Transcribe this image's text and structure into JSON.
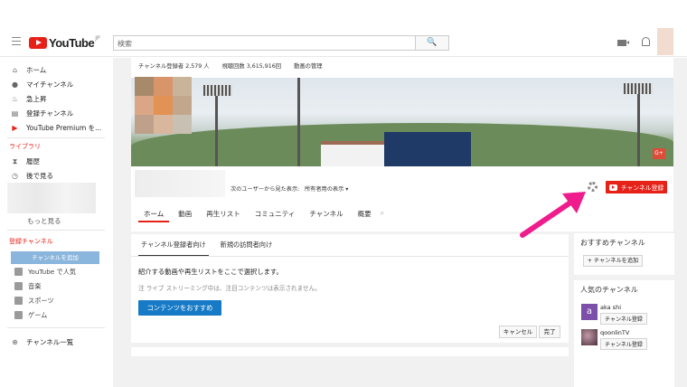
{
  "header": {
    "logo_text": "YouTube",
    "logo_region": "JP",
    "search_placeholder": "検索",
    "search_button": "🔍"
  },
  "sidebar": {
    "items": [
      {
        "label": "ホーム",
        "icon": "home-icon",
        "glyph": "⌂"
      },
      {
        "label": "マイチャンネル",
        "icon": "user-icon",
        "glyph": "●"
      },
      {
        "label": "急上昇",
        "icon": "fire-icon",
        "glyph": "♨"
      },
      {
        "label": "登録チャンネル",
        "icon": "subscriptions-icon",
        "glyph": "▤"
      },
      {
        "label": "YouTube Premium を...",
        "icon": "premium-icon",
        "glyph": "▶"
      }
    ],
    "library_heading": "ライブラリ",
    "library_items": [
      {
        "label": "履歴",
        "icon": "history-icon",
        "glyph": "⧗"
      },
      {
        "label": "後で見る",
        "icon": "clock-icon",
        "glyph": "◷"
      }
    ],
    "more_label": "もっと見る",
    "subscriptions_heading": "登録チャンネル",
    "add_channel_button": "チャンネルを追加",
    "sub_items": [
      {
        "label": "YouTube で人気"
      },
      {
        "label": "音楽"
      },
      {
        "label": "スポーツ"
      },
      {
        "label": "ゲーム"
      }
    ],
    "channel_list_label": "チャンネル一覧"
  },
  "channel": {
    "subscribers": "チャンネル登録者 2,579 人",
    "views": "視聴回数 3,615,916回",
    "manage_videos": "動画の管理",
    "viewer_label": "次のユーザーから見た表示:",
    "viewer_value": "所有者用の表示 ▾",
    "subscribe_button": "チャンネル登録",
    "gplus": "G+",
    "tabs": [
      "ホーム",
      "動画",
      "再生リスト",
      "コミュニティ",
      "チャンネル",
      "概要"
    ]
  },
  "panel": {
    "tabs": [
      "チャンネル登録者向け",
      "新規の訪問者向け"
    ],
    "intro_text": "紹介する動画や再生リストをここで選択します。",
    "note_text": "注 ライブ ストリーミング中は、注目コンテンツは表示されません。",
    "feature_button": "コンテンツをおすすめ",
    "cancel_button": "キャンセル",
    "done_button": "完了"
  },
  "right": {
    "recommended_title": "おすすめチャンネル",
    "add_channel_button": "+ チャンネルを追加",
    "popular_title": "人気のチャンネル",
    "popular": [
      {
        "name": "aka shi",
        "avatar_letter": "a",
        "avatar_color": "#7c4fa8",
        "button": "チャンネル登録"
      },
      {
        "name": "qoonlinTV",
        "avatar_letter": "",
        "avatar_color": "#5a3a4a",
        "button": "チャンネル登録"
      }
    ]
  },
  "colors": {
    "brand_red": "#e62117",
    "link_blue": "#167ac6",
    "arrow_pink": "#ee1c8c"
  }
}
